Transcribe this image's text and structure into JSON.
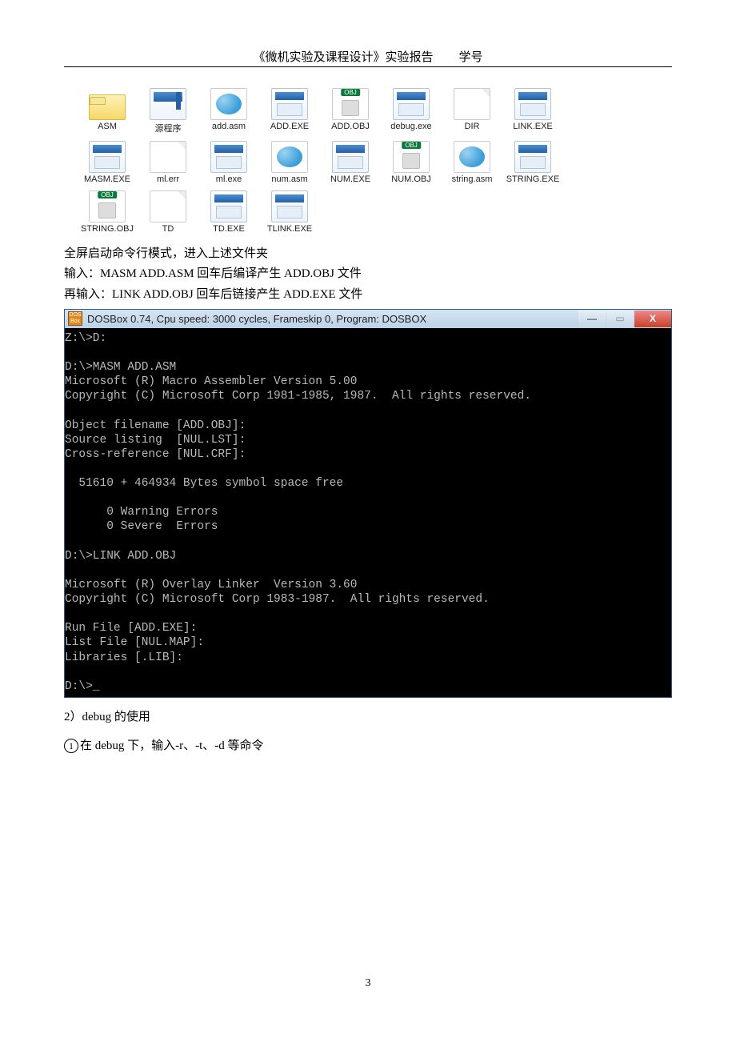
{
  "header": {
    "title": "《微机实验及课程设计》实验报告",
    "label_sid": "学号"
  },
  "files": {
    "row1": [
      {
        "name": "ASM",
        "type": "folder"
      },
      {
        "name": "源程序",
        "type": "app"
      },
      {
        "name": "add.asm",
        "type": "asm"
      },
      {
        "name": "ADD.EXE",
        "type": "exe"
      },
      {
        "name": "ADD.OBJ",
        "type": "obj"
      },
      {
        "name": "debug.exe",
        "type": "exe"
      },
      {
        "name": "DIR",
        "type": "file"
      },
      {
        "name": "LINK.EXE",
        "type": "exe"
      }
    ],
    "row2": [
      {
        "name": "MASM.EXE",
        "type": "exe"
      },
      {
        "name": "ml.err",
        "type": "file"
      },
      {
        "name": "ml.exe",
        "type": "exe"
      },
      {
        "name": "num.asm",
        "type": "asm"
      },
      {
        "name": "NUM.EXE",
        "type": "exe"
      },
      {
        "name": "NUM.OBJ",
        "type": "obj"
      },
      {
        "name": "string.asm",
        "type": "asm"
      },
      {
        "name": "STRING.EXE",
        "type": "exe"
      }
    ],
    "row3": [
      {
        "name": "STRING.OBJ",
        "type": "obj"
      },
      {
        "name": "TD",
        "type": "file"
      },
      {
        "name": "TD.EXE",
        "type": "exe"
      },
      {
        "name": "TLINK.EXE",
        "type": "exe"
      }
    ]
  },
  "instructions": {
    "l1": "全屏启动命令行模式，进入上述文件夹",
    "l2": "输入：MASM ADD.ASM 回车后编译产生 ADD.OBJ 文件",
    "l3": "再输入：LINK ADD.OBJ 回车后链接产生 ADD.EXE 文件"
  },
  "dosbox": {
    "title": "DOSBox 0.74, Cpu speed:    3000 cycles, Frameskip  0, Program:   DOSBOX",
    "buttons": {
      "min": "—",
      "max": "▭",
      "close": "X"
    },
    "lines": [
      "Z:\\>D:",
      "",
      "D:\\>MASM ADD.ASM",
      "Microsoft (R) Macro Assembler Version 5.00",
      "Copyright (C) Microsoft Corp 1981-1985, 1987.  All rights reserved.",
      "",
      "Object filename [ADD.OBJ]:",
      "Source listing  [NUL.LST]:",
      "Cross-reference [NUL.CRF]:",
      "",
      "  51610 + 464934 Bytes symbol space free",
      "",
      "      0 Warning Errors",
      "      0 Severe  Errors",
      "",
      "D:\\>LINK ADD.OBJ",
      "",
      "Microsoft (R) Overlay Linker  Version 3.60",
      "Copyright (C) Microsoft Corp 1983-1987.  All rights reserved.",
      "",
      "Run File [ADD.EXE]:",
      "List File [NUL.MAP]:",
      "Libraries [.LIB]:",
      "",
      "D:\\>_"
    ]
  },
  "after": {
    "heading": "2）debug 的使用",
    "step1_num": "1",
    "step1": "在 debug 下，输入-r、-t、-d 等命令"
  },
  "page_number": "3"
}
